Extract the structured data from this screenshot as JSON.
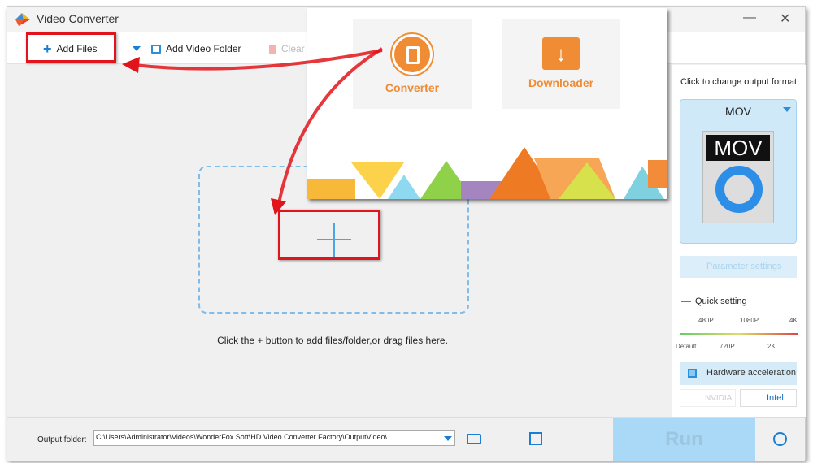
{
  "window": {
    "title": "Video Converter",
    "minimize": "—",
    "close": "✕"
  },
  "toolbar": {
    "add_files": "Add Files",
    "add_video_folder": "Add Video Folder",
    "clear": "Clear"
  },
  "main": {
    "hint": "Click the + button to add files/folder,or drag files here."
  },
  "popup": {
    "converter": "Converter",
    "downloader": "Downloader"
  },
  "right_panel": {
    "format_label": "Click to change output format:",
    "format": "MOV",
    "format_icon_text": "MOV",
    "parameter_settings": "Parameter settings",
    "quick_setting": "Quick setting",
    "quality_top": [
      "480P",
      "1080P",
      "4K"
    ],
    "quality_bottom": [
      "Default",
      "720P",
      "2K"
    ],
    "hardware_acceleration": "Hardware acceleration",
    "nvidia": "NVIDIA",
    "intel": "Intel"
  },
  "bottom": {
    "output_folder_label": "Output folder:",
    "output_folder_value": "C:\\Users\\Administrator\\Videos\\WonderFox Soft\\HD Video Converter Factory\\OutputVideo\\",
    "run": "Run"
  },
  "colors": {
    "accent": "#2a8fd8",
    "annotation": "#e0141a",
    "orange": "#ef8c34"
  }
}
